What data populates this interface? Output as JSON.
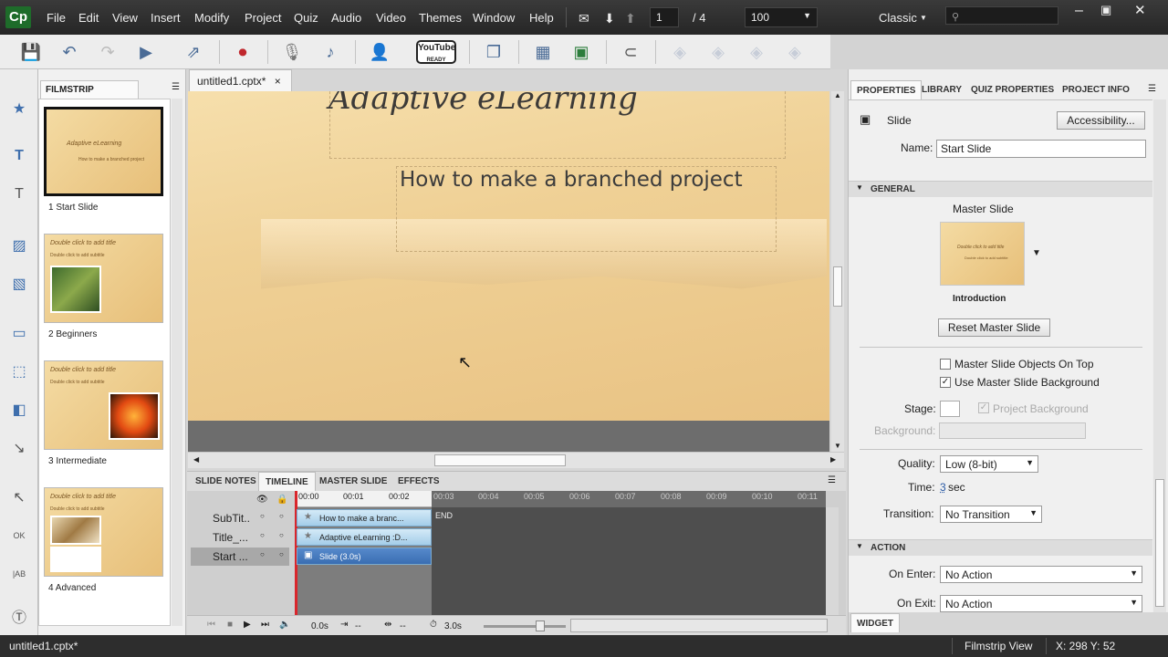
{
  "app": {
    "logo": "Cp"
  },
  "menu": [
    "File",
    "Edit",
    "View",
    "Insert",
    "Modify",
    "Project",
    "Quiz",
    "Audio",
    "Video",
    "Themes",
    "Window",
    "Help"
  ],
  "nav": {
    "current_slide": "1",
    "separator": "/ 4",
    "zoom": "100",
    "workspace": "Classic",
    "search_placeholder": ""
  },
  "toolbar": {
    "youtube_label": "YouTube",
    "youtube_sub": "READY"
  },
  "filmstrip": {
    "tab_label": "FILMSTRIP",
    "slides": [
      {
        "title": "Adaptive eLearning",
        "subtitle": "How to make a branched project",
        "caption": "1 Start Slide"
      },
      {
        "title": "Double click to add title",
        "subtitle": "Double click to add subtitle",
        "caption": "2 Beginners"
      },
      {
        "title": "Double click to add title",
        "subtitle": "Double click to add subtitle",
        "caption": "3 Intermediate"
      },
      {
        "title": "Double click to add title",
        "subtitle": "Double click to add subtitle",
        "caption": "4 Advanced"
      }
    ]
  },
  "document": {
    "tab_label": "untitled1.cptx*",
    "close": "×"
  },
  "stage": {
    "title": "Adaptive eLearning",
    "subtitle": "How to make a branched project"
  },
  "timeline": {
    "tabs": [
      "SLIDE NOTES",
      "TIMELINE",
      "MASTER SLIDE",
      "EFFECTS"
    ],
    "ruler": [
      "00:00",
      "00:01",
      "00:02",
      "00:03",
      "00:04",
      "00:05",
      "00:06",
      "00:07",
      "00:08",
      "00:09",
      "00:10",
      "00:11"
    ],
    "layers": [
      {
        "name": "SubTit..",
        "track": "How to make a branc..."
      },
      {
        "name": "Title_...",
        "track": "Adaptive eLearning :D..."
      },
      {
        "name": "Start ...",
        "track": "Slide (3.0s)"
      }
    ],
    "end_label": "END",
    "time_start": "0.0s",
    "time_a": "--",
    "time_b": "--",
    "duration": "3.0s"
  },
  "properties": {
    "tabs": [
      "PROPERTIES",
      "LIBRARY",
      "QUIZ PROPERTIES",
      "PROJECT INFO"
    ],
    "object_type": "Slide",
    "accessibility_button": "Accessibility...",
    "name_label": "Name:",
    "name_value": "Start Slide",
    "general_header": "GENERAL",
    "master_slide_label": "Master Slide",
    "master_thumb_title": "Double click to add title",
    "master_thumb_sub": "Double click to add subtitle",
    "master_name": "Introduction",
    "reset_button": "Reset Master Slide",
    "cb_master_objects": "Master Slide Objects On Top",
    "cb_use_bg": "Use Master Slide Background",
    "stage_label": "Stage:",
    "project_bg": "Project Background",
    "background_label": "Background:",
    "quality_label": "Quality:",
    "quality_value": "Low (8-bit)",
    "time_label": "Time:",
    "time_value": "3",
    "time_unit": "sec",
    "transition_label": "Transition:",
    "transition_value": "No Transition",
    "action_header": "ACTION",
    "on_enter_label": "On Enter:",
    "on_enter_value": "No Action",
    "on_exit_label": "On Exit:",
    "on_exit_value": "No Action",
    "widget_tab": "WIDGET"
  },
  "status": {
    "file": "untitled1.cptx*",
    "view": "Filmstrip View",
    "coords": "X: 298 Y: 52"
  },
  "colors": {
    "accent": "#3a6eb2",
    "stage_bg": "#efd095",
    "menubar": "#2e2e2e"
  }
}
